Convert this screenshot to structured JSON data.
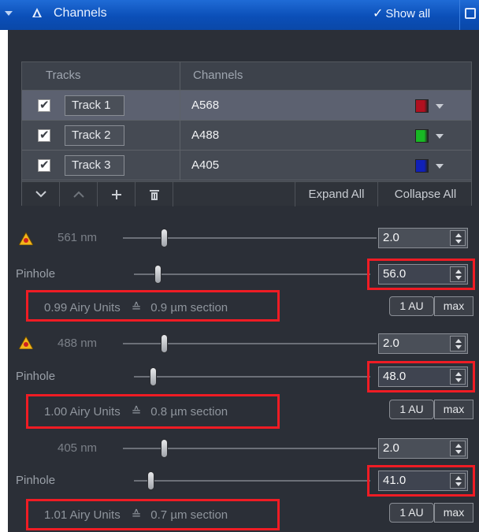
{
  "header": {
    "title": "Channels",
    "show_all": "Show all"
  },
  "table": {
    "columns": [
      "Tracks",
      "Channels"
    ],
    "rows": [
      {
        "checked": true,
        "track": "Track 1",
        "channel": "A568",
        "color": "#b01020"
      },
      {
        "checked": true,
        "track": "Track 2",
        "channel": "A488",
        "color": "#18b824"
      },
      {
        "checked": true,
        "track": "Track 3",
        "channel": "A405",
        "color": "#1020b8"
      }
    ],
    "toolbar": {
      "expand_all": "Expand All",
      "collapse_all": "Collapse All"
    }
  },
  "lasers": [
    {
      "wavelength": "561 nm",
      "power": "2.0",
      "pinhole_label": "Pinhole",
      "pinhole": "56.0",
      "airy_units": "0.99 Airy Units",
      "eq": "≙",
      "section": "0.9 µm section",
      "au_btn": "1 AU",
      "max_btn": "max",
      "level": 0.16,
      "pinhole_level": 0.1
    },
    {
      "wavelength": "488 nm",
      "power": "2.0",
      "pinhole_label": "Pinhole",
      "pinhole": "48.0",
      "airy_units": "1.00 Airy Units",
      "eq": "≙",
      "section": "0.8 µm section",
      "au_btn": "1 AU",
      "max_btn": "max",
      "level": 0.16,
      "pinhole_level": 0.08
    },
    {
      "wavelength": "405 nm",
      "power": "2.0",
      "pinhole_label": "Pinhole",
      "pinhole": "41.0",
      "airy_units": "1.01 Airy Units",
      "eq": "≙",
      "section": "0.7 µm section",
      "au_btn": "1 AU",
      "max_btn": "max",
      "level": 0.16,
      "pinhole_level": 0.07
    }
  ],
  "colors": {
    "highlight": "#ef1c24",
    "header_blue": "#0b4fb8",
    "panel": "#2b2f37"
  },
  "icons": [
    "chevron-down-icon",
    "laser-warning-icon",
    "checkbox-icon",
    "trash-icon",
    "plus-icon"
  ]
}
